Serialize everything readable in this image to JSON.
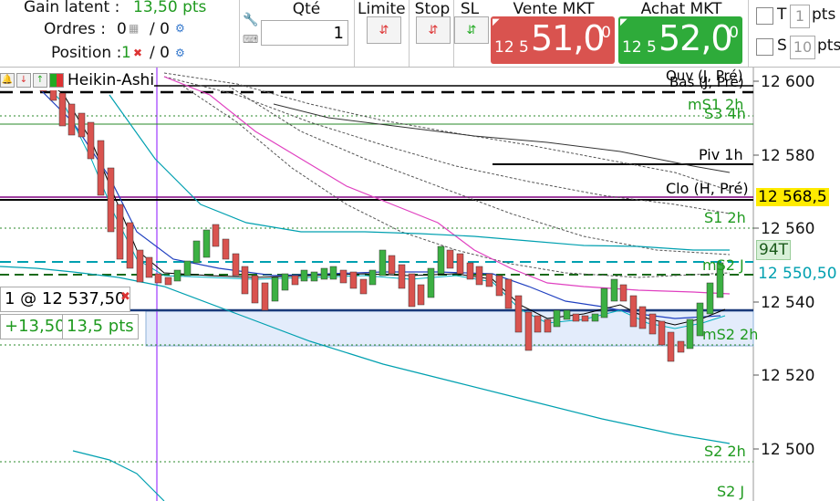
{
  "summary": {
    "gain_label": "Gain latent :",
    "gain_value": "13,50 pts",
    "orders_label": "Ordres :",
    "orders_value": "0",
    "orders_suffix": "/ 0",
    "position_label": "Position :",
    "position_value": "1",
    "position_suffix": "/ 0"
  },
  "order_panel": {
    "qty_header": "Qté",
    "qty_value": "1",
    "limit_header": "Limite",
    "stop_header": "Stop",
    "sl_header": "SL",
    "sell": {
      "label": "Vente MKT",
      "small": "12 5",
      "big": "51,0",
      "sup": "0",
      "color": "#d9534f"
    },
    "buy": {
      "label": "Achat MKT",
      "small": "12 5",
      "big": "52,0",
      "sup": "0",
      "color": "#2eab3a"
    },
    "t_label": "T",
    "t_value": "1",
    "t_unit": "pts",
    "s_label": "S",
    "s_value": "10",
    "s_unit": "pts"
  },
  "chart_header": {
    "type_label": "Heikin-Ashi"
  },
  "price_axis": {
    "ticks": [
      "12 600",
      "12 580",
      "12 560",
      "12 540",
      "12 520",
      "12 500"
    ],
    "last_price": "12 568,5",
    "ticker_label": "94T",
    "cyan_price": "12 550,50"
  },
  "levels": {
    "ouv": "Ouv (J, Pré)",
    "bas": "Bas (J, Pré)",
    "ms1_2h": "mS1 2h",
    "s3_4h": "S3 4h",
    "piv_1h": "Piv 1h",
    "clo": "Clo (H, Pré)",
    "s1_2h": "S1 2h",
    "ms2_j": "mS2 J",
    "ms2_2h": "mS2 2h",
    "s2_2h": "S2 2h",
    "s2_j": "S2 J"
  },
  "position_box": {
    "label": "1 @ 12 537,50",
    "pnl": "+13,50",
    "pts": "13,5 pts"
  },
  "colors": {
    "green": "#1f9a1f",
    "red": "#d9534f",
    "cyan": "#00a0b0",
    "magenta": "#e040c0",
    "purple_line": "#b060ff"
  }
}
